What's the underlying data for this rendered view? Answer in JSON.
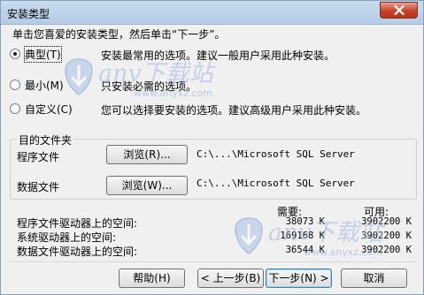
{
  "window": {
    "title": "安装类型"
  },
  "instruction": "单击您喜爱的安装类型，然后单击“下一步”。",
  "options": [
    {
      "label": "典型(T)",
      "description": "安装最常用的选项。建议一般用户采用此种安装。",
      "checked": true
    },
    {
      "label": "最小(M)",
      "description": "只安装必需的选项。",
      "checked": false
    },
    {
      "label": "自定义(C)",
      "description": "您可以选择要安装的选项。建议高级用户采用此种安装。",
      "checked": false
    }
  ],
  "destination": {
    "group_title": "目的文件夹",
    "program_files": {
      "label": "程序文件",
      "browse": "浏览(R)...",
      "path": "C:\\...\\Microsoft SQL Server"
    },
    "data_files": {
      "label": "数据文件",
      "browse": "浏览(W)...",
      "path": "C:\\...\\Microsoft SQL Server"
    }
  },
  "space": {
    "required_header": "需要:",
    "available_header": "可用:",
    "rows": [
      {
        "label": "程序文件驱动器上的空间:",
        "required": "38073 K",
        "available": "3902200 K"
      },
      {
        "label": "系统驱动器上的空间:",
        "required": "169168 K",
        "available": "3902200 K"
      },
      {
        "label": "数据文件驱动器上的空间:",
        "required": "36544 K",
        "available": "3902200 K"
      }
    ]
  },
  "buttons": {
    "help": "帮助(H)",
    "back": "< 上一步(B)",
    "next": "下一步(N) >",
    "cancel": "取消"
  },
  "watermark": {
    "brand": "anv下载站",
    "url": "www.anyxz.com"
  }
}
